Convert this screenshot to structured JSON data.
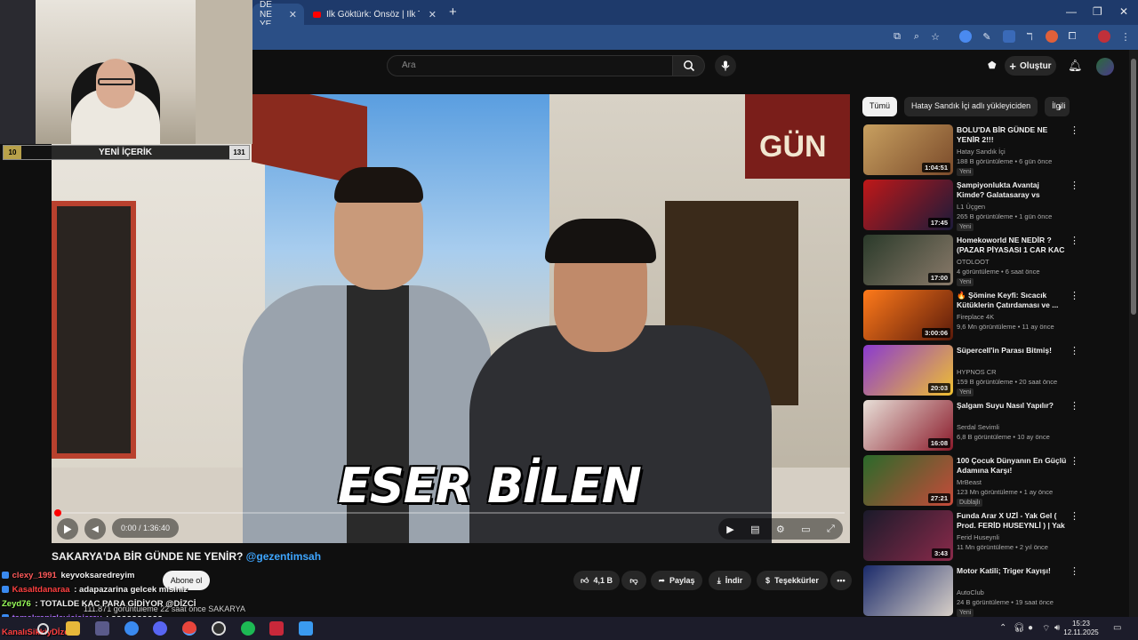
{
  "browser": {
    "tabs": [
      {
        "label": "DE NE YE",
        "active": true
      },
      {
        "label": "İlk Göktürk: Önsöz | İlk Tanıtım",
        "active": false
      }
    ],
    "new_tab": "+",
    "window_controls": [
      "—",
      "❐",
      "✕"
    ]
  },
  "youtube_header": {
    "search_placeholder": "Ara",
    "create_label": "Oluştur"
  },
  "player": {
    "caption": "ESER BİLEN",
    "time": "0:00 / 1:36:40",
    "progress_fraction": 0.0
  },
  "video": {
    "title": "SAKARYA'DA BİR GÜNDE NE YENİR?",
    "handle": "@gezentimsah",
    "subscribe_label": "Abone ol",
    "likes": "4,1 B",
    "share_label": "Paylaş",
    "download_label": "İndir",
    "thanks_label": "Teşekkürler",
    "more_label": "•••",
    "views_line": "111.871 görüntüleme  22 saat önce  SAKARYA"
  },
  "sidebar": {
    "chips": [
      "Tümü",
      "Hatay Sandık İçi adlı yükleyiciden",
      "İlgili"
    ],
    "items": [
      {
        "title": "BOLU'DA BİR GÜNDE NE YENİR 2!!!",
        "channel": "Hatay Sandık İçi",
        "meta": "188 B görüntüleme • 6 gün önce",
        "badge": "Yeni",
        "duration": "1:04:51"
      },
      {
        "title": "Şampiyonlukta Avantaj Kimde? Galatasaray vs Fenerbahçe",
        "channel": "L1 Üçgen",
        "meta": "265 B görüntüleme • 1 gün önce",
        "badge": "Yeni",
        "duration": "17:45"
      },
      {
        "title": "Homekoworld NE NEDİR ? (PAZAR PİYASASI 1 CAR KAC ...",
        "channel": "OTOLOOT",
        "meta": "4 görüntüleme • 6 saat önce",
        "badge": "Yeni",
        "duration": "17:00"
      },
      {
        "title": "🔥 Şömine Keyfi: Sıcacık Kütüklerin Çatırdaması ve ...",
        "channel": "Fireplace 4K",
        "meta": "9,6 Mn görüntüleme • 11 ay önce",
        "badge": "",
        "duration": "3:00:06"
      },
      {
        "title": "Süpercell'in Parası Bitmiş!",
        "channel": "HYPNOS CR",
        "meta": "159 B görüntüleme • 20 saat önce",
        "badge": "Yeni",
        "duration": "20:03"
      },
      {
        "title": "Şalgam Suyu Nasıl Yapılır?",
        "channel": "Serdal Sevimli",
        "meta": "6,8 B görüntüleme • 10 ay önce",
        "badge": "",
        "duration": "16:08"
      },
      {
        "title": "100 Çocuk Dünyanın En Güçlü Adamına Karşı!",
        "channel": "MrBeast",
        "meta": "123 Mn görüntüleme • 1 ay önce",
        "badge": "Dublajlı",
        "duration": "27:21"
      },
      {
        "title": "Funda Arar X UZİ - Yak Gel ( Prod. FERİD HUSEYNLİ ) | Yak ...",
        "channel": "Ferid Huseynli",
        "meta": "11 Mn görüntüleme • 2 yıl önce",
        "badge": "",
        "duration": "3:43"
      },
      {
        "title": "Motor Katili; Triger Kayışı!",
        "channel": "AutoClub",
        "meta": "24 B görüntüleme • 19 saat önce",
        "badge": "Yeni",
        "duration": ""
      }
    ]
  },
  "stream_overlay": {
    "counter_left": "10",
    "counter_label": "YENİ İÇERİK",
    "counter_right": "131",
    "chat": [
      {
        "user": "clexy_1991",
        "message": "keyvoksaredreyim",
        "color": "#ff5a5a"
      },
      {
        "user": "Kasaltdanaraa",
        "message": ": adapazarina gelcek misiniz",
        "color": "#ff4040"
      },
      {
        "user": "Zeyd76",
        "message": ": TOTALDE KAC PARA GİDİYOR @DİZCİ",
        "color": "#9aff5a"
      },
      {
        "user": "tamekranizleyicisieray",
        "message": ": oooooooooo",
        "color": "#b070ff"
      },
      {
        "user": "KanalıSikkiyDİzci",
        "message": "",
        "color": "#ff4040"
      }
    ]
  },
  "taskbar": {
    "time": "15:23",
    "date": "12.11.2025"
  },
  "colors": {
    "accent_red": "#ff0000",
    "link_blue": "#3ea6ff",
    "tab_bar": "#1e3a6b"
  }
}
